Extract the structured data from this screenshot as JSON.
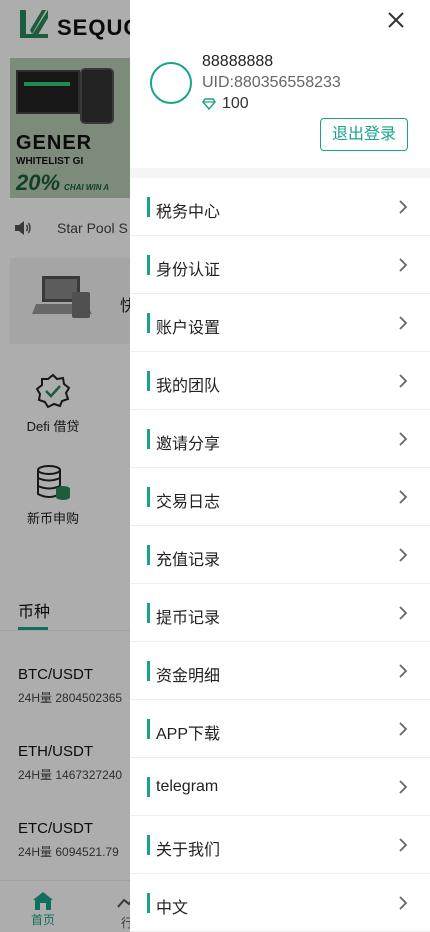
{
  "app": {
    "logo_text": "SEQUO",
    "banner": {
      "title": "GENER",
      "subtitle": "WHITELIST GI",
      "percent": "20%",
      "percent_side": "CHAI WIN A"
    },
    "notice_text": "Star Pool S",
    "promo_text": "快",
    "quick_items": [
      {
        "label": "Defi 借贷",
        "icon": "badge-check-icon"
      },
      {
        "label": "新币申购",
        "icon": "database-coins-icon"
      }
    ],
    "section_tab": "币种",
    "coins": [
      {
        "pair": "BTC/USDT",
        "volume": "24H量 2804502365"
      },
      {
        "pair": "ETH/USDT",
        "volume": "24H量 1467327240"
      },
      {
        "pair": "ETC/USDT",
        "volume": "24H量 6094521.79"
      }
    ],
    "bottom_nav": [
      {
        "label": "首页",
        "icon": "home-icon",
        "active": true
      },
      {
        "label": "行",
        "icon": "market-icon",
        "active": false
      }
    ]
  },
  "drawer": {
    "user": {
      "name": "88888888",
      "uid": "UID:880356558233",
      "points": "100"
    },
    "logout_label": "退出登录",
    "menu_items": [
      {
        "label": "税务中心"
      },
      {
        "label": "身份认证"
      },
      {
        "label": "账户设置"
      },
      {
        "label": "我的团队"
      },
      {
        "label": "邀请分享"
      },
      {
        "label": "交易日志"
      },
      {
        "label": "充值记录"
      },
      {
        "label": "提币记录"
      },
      {
        "label": "资金明细"
      },
      {
        "label": "APP下载"
      },
      {
        "label": "telegram"
      },
      {
        "label": "关于我们"
      },
      {
        "label": "中文"
      }
    ]
  },
  "colors": {
    "accent": "#1aa38b",
    "overlay": "rgba(0,0,0,0.32)"
  }
}
